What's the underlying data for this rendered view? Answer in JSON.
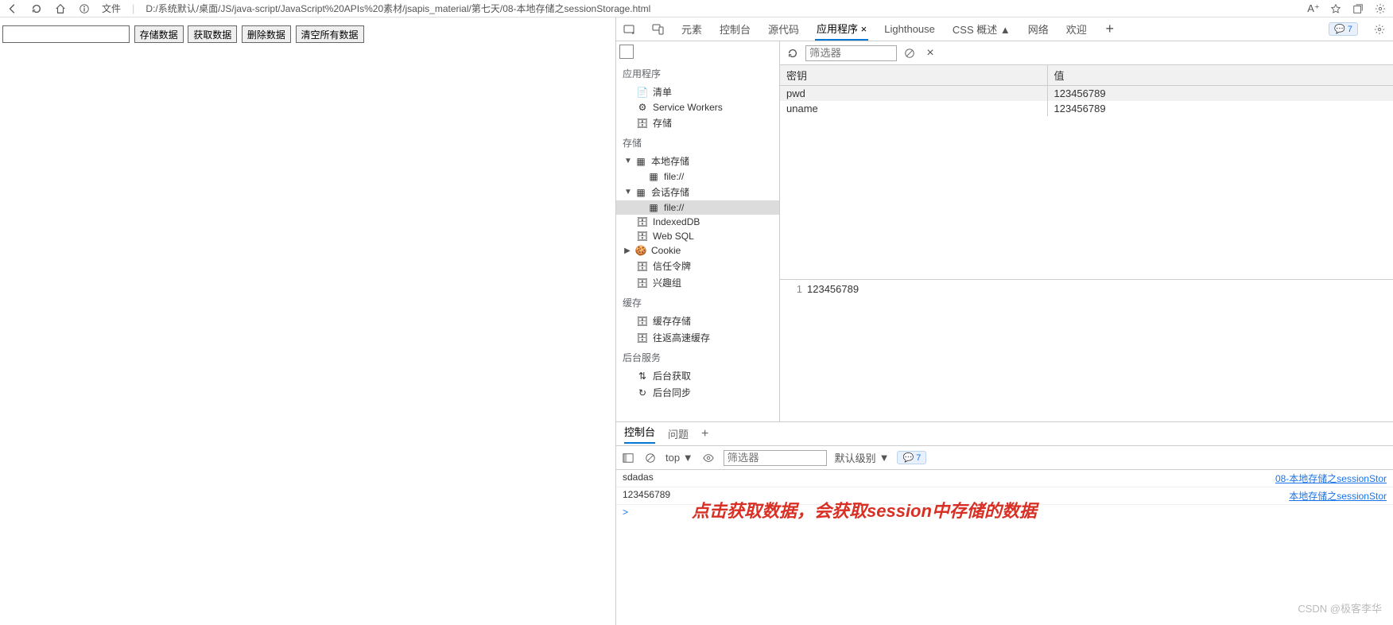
{
  "topbar": {
    "prefix": "文件",
    "url": "D:/系统默认/桌面/JS/java-script/JavaScript%20APIs%20素材/jsapis_material/第七天/08-本地存储之sessionStorage.html"
  },
  "page": {
    "input_value": "",
    "btn_store": "存储数据",
    "btn_get": "获取数据",
    "btn_del": "删除数据",
    "btn_clear": "清空所有数据"
  },
  "devtabs": {
    "elements": "元素",
    "console": "控制台",
    "sources": "源代码",
    "application": "应用程序",
    "lighthouse": "Lighthouse",
    "cssoverview": "CSS 概述",
    "cssflag": "▲",
    "network": "网络",
    "welcome": "欢迎",
    "issue_count": "7"
  },
  "apppanel": {
    "group_app": "应用程序",
    "manifest": "清单",
    "sw": "Service Workers",
    "storage_item": "存储",
    "group_storage": "存储",
    "local": "本地存储",
    "local_child": "file://",
    "session": "会话存储",
    "session_child": "file://",
    "indexeddb": "IndexedDB",
    "websql": "Web SQL",
    "cookie": "Cookie",
    "trust": "信任令牌",
    "interest": "兴趣组",
    "group_cache": "缓存",
    "cache_storage": "缓存存储",
    "bfcache": "往返高速缓存",
    "group_bg": "后台服务",
    "bg_fetch": "后台获取",
    "bg_sync": "后台同步"
  },
  "storage": {
    "filter_placeholder": "筛选器",
    "col_key": "密钥",
    "col_val": "值",
    "rows": [
      {
        "k": "pwd",
        "v": "123456789"
      },
      {
        "k": "uname",
        "v": "123456789"
      }
    ],
    "detail_line": "1",
    "detail_val": "123456789"
  },
  "drawer": {
    "tab_console": "控制台",
    "tab_issues": "问题",
    "ctx": "top",
    "filter_placeholder": "筛选器",
    "level_label": "默认级别",
    "bubble": "7",
    "rows": [
      {
        "msg": "sdadas",
        "src": "08-本地存储之sessionStor"
      },
      {
        "msg": "123456789",
        "src": "本地存储之sessionStor"
      }
    ],
    "prompt": ">"
  },
  "overlay": "点击获取数据，会获取session中存储的数据",
  "watermark": "CSDN @极客李华"
}
